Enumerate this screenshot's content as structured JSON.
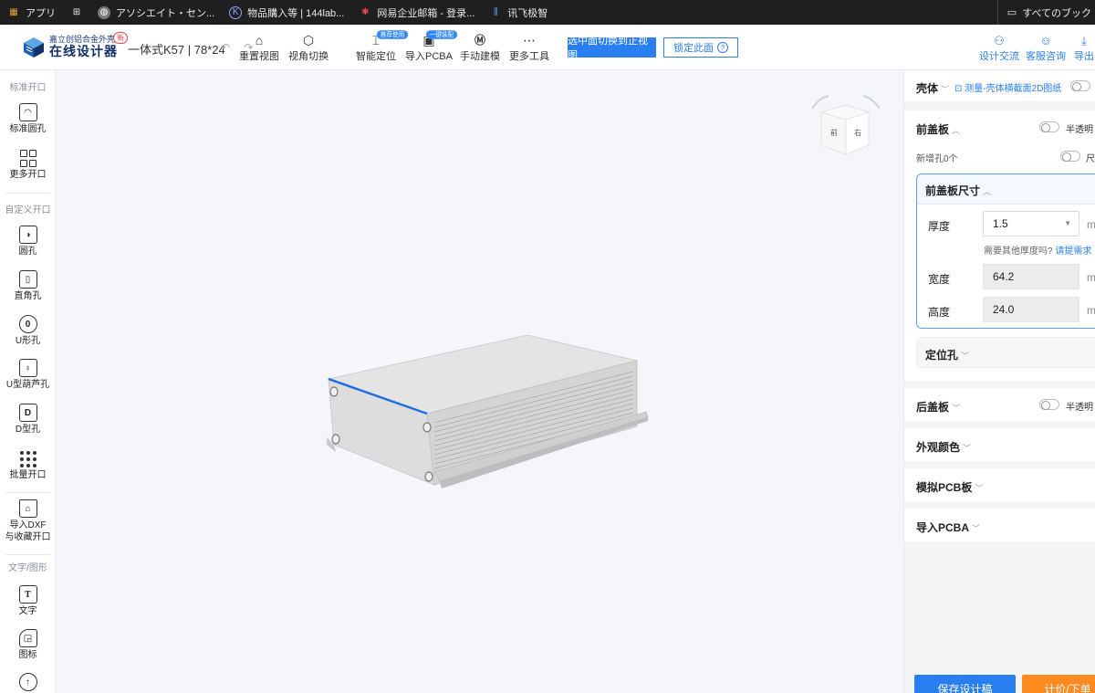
{
  "bookmarks": {
    "items": [
      {
        "label": "アプリ",
        "icon": "apps-grid-icon"
      },
      {
        "label": "",
        "icon": "tab-grid-icon"
      },
      {
        "label": "アソシエイト・セン...",
        "icon": "globe-icon"
      },
      {
        "label": "物品購入等 | 144lab...",
        "icon": "k-logo-icon"
      },
      {
        "label": "网易企业邮箱 - 登录...",
        "icon": "netease-icon"
      },
      {
        "label": "讯飞极智",
        "icon": "iflytek-icon"
      }
    ],
    "all_label": "すべてのブック"
  },
  "header": {
    "logo_sub": "嘉立创铝合金外壳",
    "logo_main": "在线设计器",
    "logo_badge": "新",
    "model": "一体式K57 | 78*24",
    "undo_icons": "↶ ↷",
    "tools": [
      {
        "label": "重置视图",
        "icon": "home-icon",
        "badge": ""
      },
      {
        "label": "视角切换",
        "icon": "cube-icon",
        "badge": ""
      },
      {
        "label": "智能定位",
        "icon": "position-icon",
        "badge": "推荐使用"
      },
      {
        "label": "导入PCBA",
        "icon": "pcba-icon",
        "badge": "一键装配"
      },
      {
        "label": "手动建模",
        "icon": "m-hex-icon",
        "badge": ""
      },
      {
        "label": "更多工具",
        "icon": "more-dots-icon",
        "badge": ""
      }
    ],
    "switch_view_button": "选中面切换到正视图",
    "lock_face_button": "锁定此面",
    "right_tools": [
      {
        "label": "设计交流",
        "icon": "group-icon"
      },
      {
        "label": "客服咨询",
        "icon": "support-icon"
      },
      {
        "label": "导出",
        "icon": "download-icon"
      }
    ]
  },
  "sidebar": {
    "section_standard": "标准开口",
    "standard_items": [
      {
        "label": "标准圆孔",
        "icon": "standard-hole-icon"
      },
      {
        "label": "更多开口",
        "icon": "grid-icon"
      }
    ],
    "section_custom": "自定义开口",
    "custom_items": [
      {
        "label": "圆孔",
        "icon": "round-hole-icon"
      },
      {
        "label": "直角孔",
        "icon": "rect-hole-icon"
      },
      {
        "label": "U形孔",
        "icon": "u-hole-icon"
      },
      {
        "label": "U型葫芦孔",
        "icon": "keyhole-icon"
      },
      {
        "label": "D型孔",
        "icon": "d-hole-icon"
      },
      {
        "label": "批量开口",
        "icon": "batch-dots-icon"
      }
    ],
    "import_dxf_line1": "导入DXF",
    "import_dxf_line2": "与收藏开口",
    "section_text": "文字/图形",
    "text_items": [
      {
        "label": "文字",
        "icon": "text-icon"
      },
      {
        "label": "图标",
        "icon": "shapes-icon"
      }
    ]
  },
  "viewcube": {
    "face_front": "前",
    "face_right": "右"
  },
  "panel": {
    "shell_label": "壳体",
    "measure_link": "测量-壳体横截面2D图纸",
    "front_cover": {
      "title": "前盖板",
      "translucent": "半透明",
      "new_holes": "新增孔0个",
      "size_toggle_label": "尺",
      "size_title": "前盖板尺寸",
      "thickness_label": "厚度",
      "thickness_value": "1.5",
      "hint_text": "需要其他厚度吗?",
      "hint_link": "请提需求",
      "width_label": "宽度",
      "width_value": "64.2",
      "height_label": "高度",
      "height_value": "24.0",
      "unit": "m",
      "locate_holes": "定位孔"
    },
    "back_cover": {
      "title": "后盖板",
      "translucent": "半透明"
    },
    "appearance": "外观颜色",
    "pcb_sim": "模拟PCB板",
    "import_pcba": "导入PCBA",
    "save_button": "保存设计稿",
    "quote_button": "计价/下单"
  },
  "colors": {
    "accent": "#2a7ff0",
    "orange": "#ff8a1f",
    "canvas_bg": "#f4f6fb",
    "selected_edge": "#1f6fe0"
  }
}
